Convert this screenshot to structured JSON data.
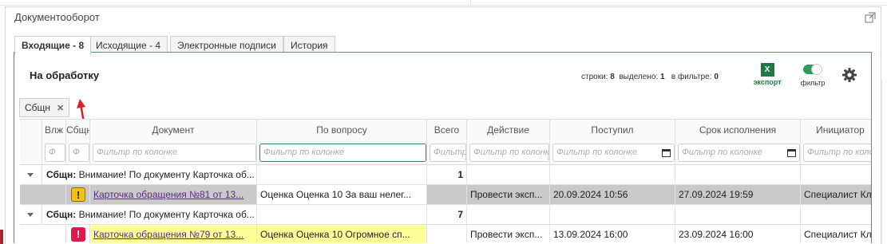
{
  "window": {
    "title": "Документооборот"
  },
  "tabs": [
    {
      "label": "Входящие - 8",
      "active": true
    },
    {
      "label": "Исходящие - 4",
      "active": false
    },
    {
      "label": "Электронные подписи",
      "active": false
    },
    {
      "label": "История",
      "active": false
    }
  ],
  "panel": {
    "title": "На обработку",
    "stats": {
      "rows_label": "строки:",
      "rows": "8",
      "selected_label": "выделено:",
      "selected": "1",
      "filtered_label": "в фильтре:",
      "filtered": "0"
    },
    "export_label": "экспорт",
    "export_icon": "excel-icon",
    "filter_label": "фильтр",
    "filter_on": true,
    "settings_icon": "gear-icon"
  },
  "group_chip": {
    "label": "Сбщн"
  },
  "grid": {
    "columns": [
      "Влж",
      "Сбщн",
      "Документ",
      "По вопросу",
      "Всего",
      "Действие",
      "Поступил",
      "Срок исполнения",
      "Инициатор"
    ],
    "filter_placeholder": "Фильтр по колонке",
    "filter_short": "Ф",
    "rows": [
      {
        "kind": "group",
        "prefix": "Сбщн:",
        "text": "Внимание! По документу Карточка об...",
        "total": "1"
      },
      {
        "kind": "data",
        "badge": "!",
        "badge_type": "warning",
        "document": "Карточка обращения №81 от 13...",
        "question": "Оценка Оценка 10 За ваш нелег...",
        "action": "Провести эксп...",
        "received": "20.09.2024 10:56",
        "deadline": "27.09.2024 19:59",
        "initiator": "Специалист Кл..."
      },
      {
        "kind": "group",
        "prefix": "Сбщн:",
        "text": "Внимание! По документу Карточка об...",
        "total": "7"
      },
      {
        "kind": "data",
        "badge": "!",
        "badge_type": "critical",
        "document": "Карточка обращения №79 от 13...",
        "question": "Оценка Оценка 10 Огромное сп...",
        "action": "Провести эксп...",
        "received": "13.09.2024 16:00",
        "deadline": "23.09.2024 16:00",
        "initiator": "Специалист Кл..."
      }
    ]
  },
  "colors": {
    "accent": "#2e9b5e",
    "border_accent": "#38a06a",
    "warning": "#f4c20d",
    "critical": "#e0184a",
    "highlight": "#ffff99",
    "selected_row": "#c9c9c9",
    "link": "#5a2a8a"
  }
}
